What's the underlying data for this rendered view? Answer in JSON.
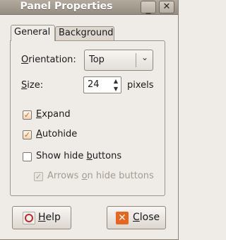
{
  "window": {
    "title": "Panel Properties",
    "minimize_glyph": "_",
    "close_glyph": "✕"
  },
  "tabs": [
    {
      "label": "General",
      "selected": true
    },
    {
      "label": "Background",
      "selected": false
    }
  ],
  "orientation": {
    "label_mnemonic": "O",
    "label_rest": "rientation:",
    "value": "Top"
  },
  "size": {
    "label_mnemonic": "S",
    "label_rest": "ize:",
    "value": "24",
    "unit": "pixels"
  },
  "options": {
    "expand": {
      "label_mnemonic": "E",
      "label_rest": "xpand",
      "checked": true
    },
    "autohide": {
      "label_mnemonic": "A",
      "label_rest": "utohide",
      "checked": true
    },
    "show_hide_buttons": {
      "label_pre": "Show hide ",
      "label_mnemonic": "b",
      "label_rest": "uttons",
      "checked": false
    },
    "arrows": {
      "label_pre": "Arrows ",
      "label_mnemonic": "o",
      "label_rest": "n hide buttons",
      "checked": true,
      "enabled": false
    }
  },
  "buttons": {
    "help": {
      "label_mnemonic": "H",
      "label_rest": "elp"
    },
    "close": {
      "label_mnemonic": "C",
      "label_rest": "lose"
    }
  },
  "icons": {
    "combo_arrow": "⌄",
    "spin_up": "▲",
    "spin_down": "▼",
    "check": "✓",
    "close_x": "✕"
  }
}
